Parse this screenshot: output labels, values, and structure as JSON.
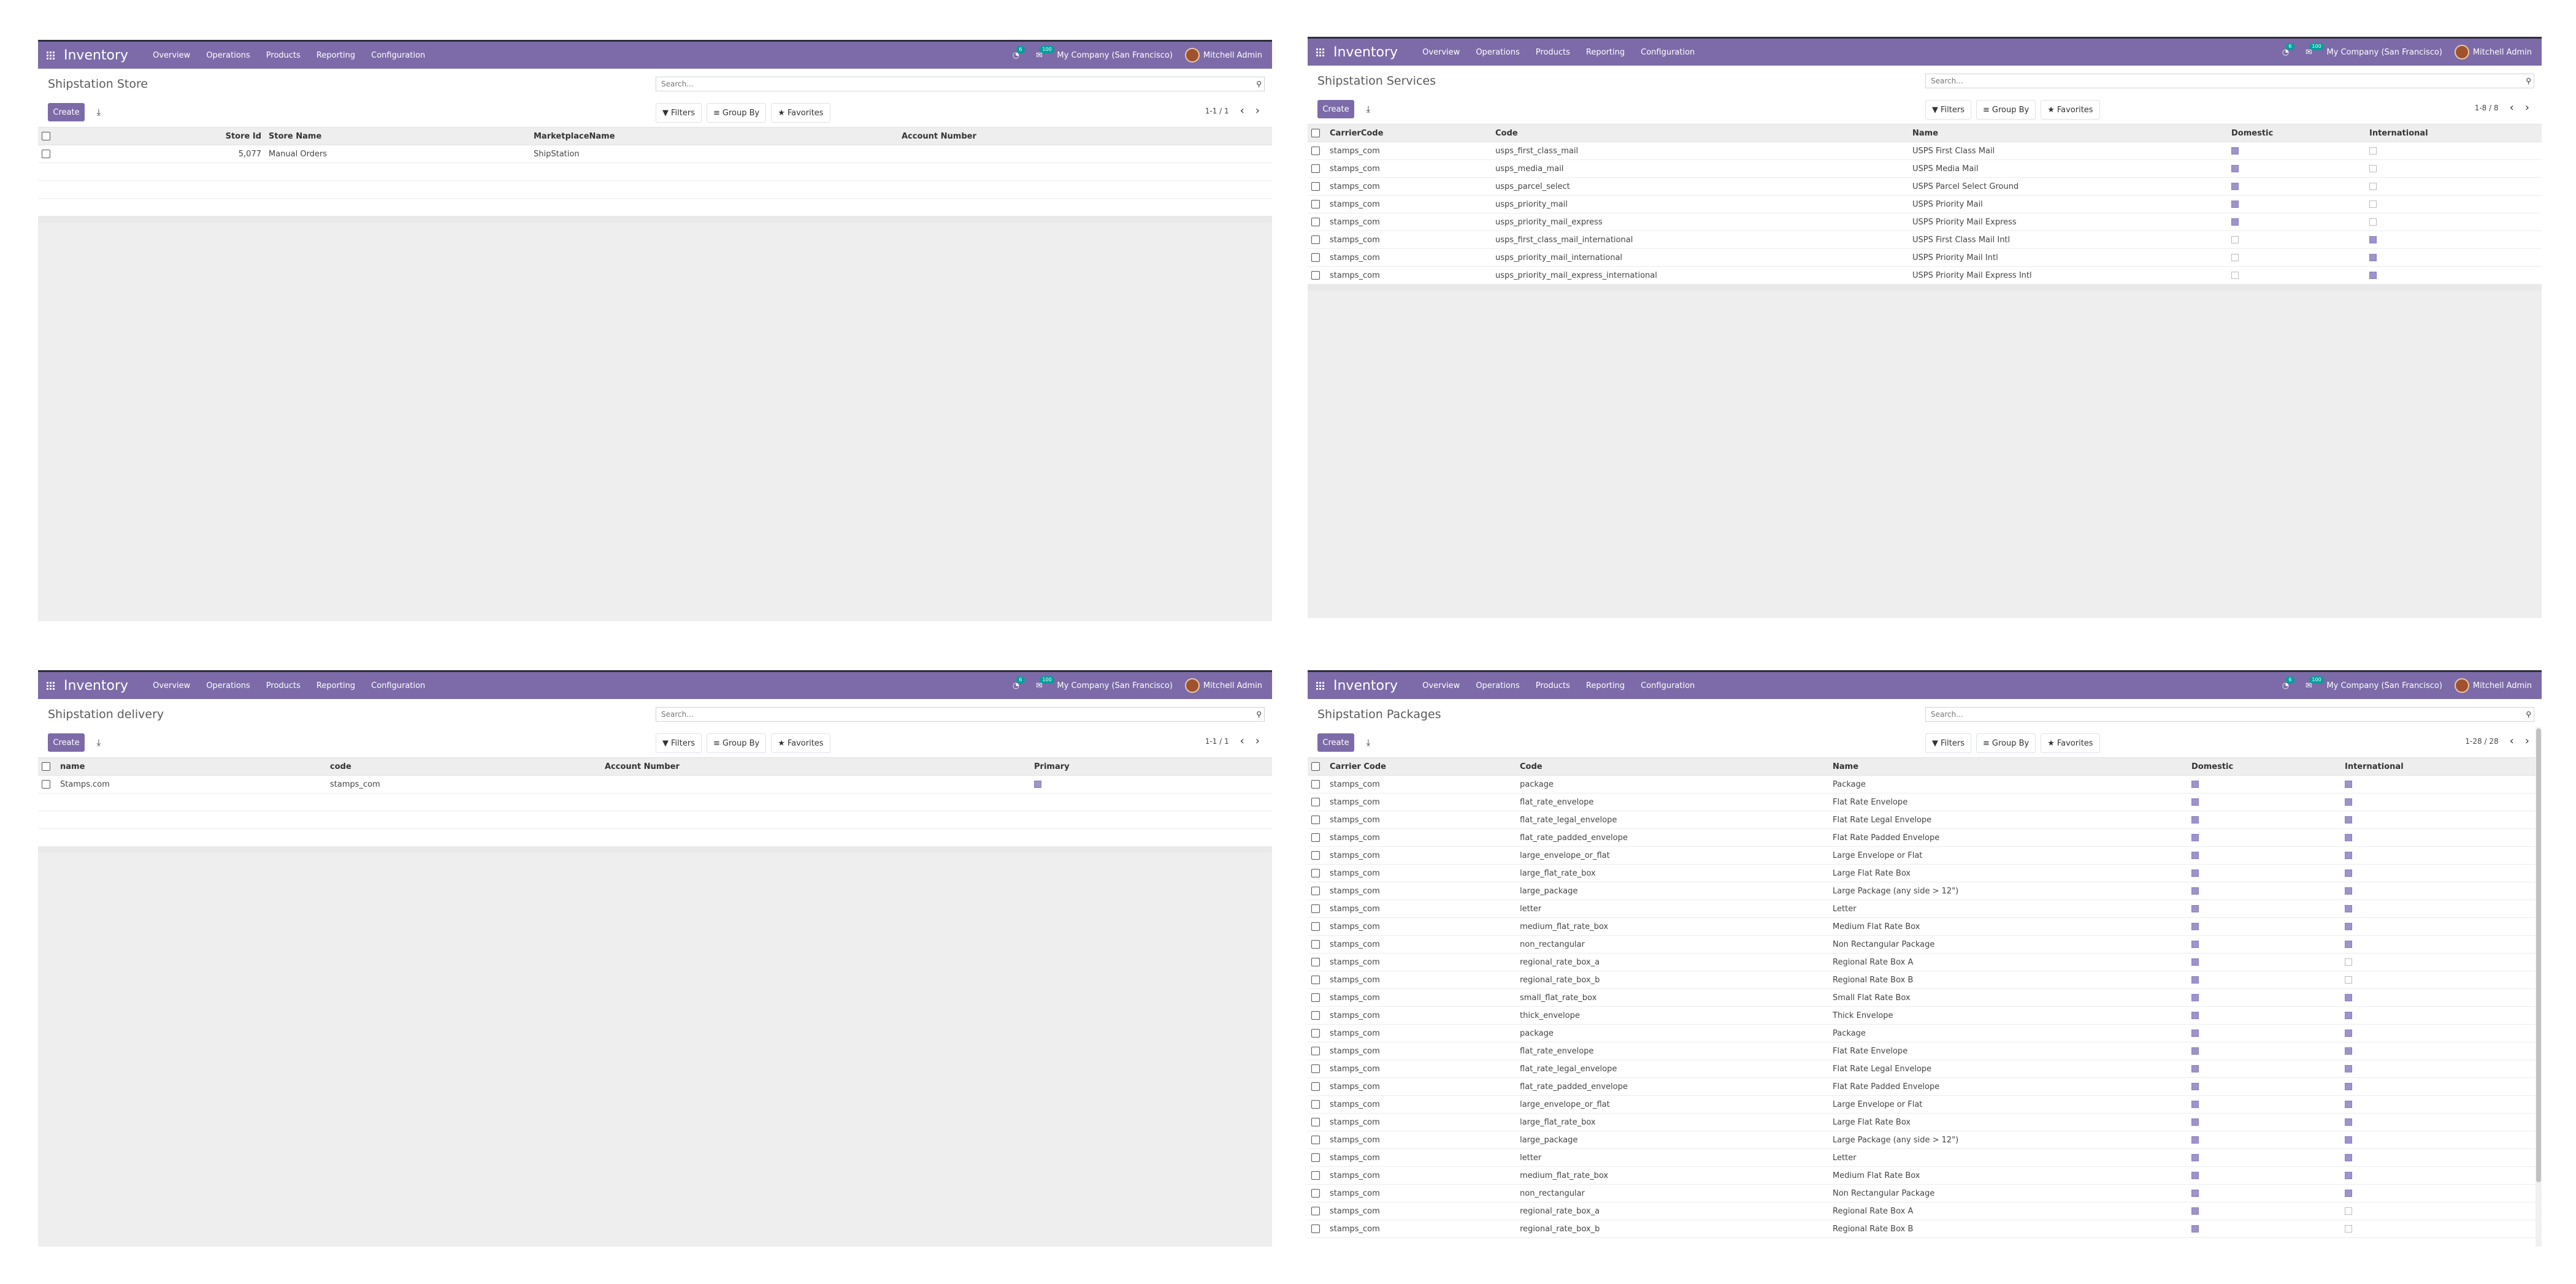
{
  "navbar": {
    "app_name": "Inventory",
    "menu": [
      "Overview",
      "Operations",
      "Products",
      "Reporting",
      "Configuration"
    ],
    "activity_badge": "6",
    "messages_badge": "100",
    "company": "My Company (San Francisco)",
    "user": "Mitchell Admin"
  },
  "common": {
    "create_label": "Create",
    "filters_label": "Filters",
    "groupby_label": "Group By",
    "favorites_label": "Favorites",
    "search_placeholder": "Search..."
  },
  "store": {
    "title": "Shipstation Store",
    "pager": "1-1 / 1",
    "columns": [
      "Store Id",
      "Store Name",
      "MarketplaceName",
      "Account Number"
    ],
    "rows": [
      [
        "5,077",
        "Manual Orders",
        "ShipStation",
        ""
      ]
    ]
  },
  "services": {
    "title": "Shipstation Services",
    "pager": "1-8 / 8",
    "columns": [
      "CarrierCode",
      "Code",
      "Name",
      "Domestic",
      "International"
    ],
    "rows": [
      {
        "carrier": "stamps_com",
        "code": "usps_first_class_mail",
        "name": "USPS First Class Mail",
        "domestic": true,
        "international": false
      },
      {
        "carrier": "stamps_com",
        "code": "usps_media_mail",
        "name": "USPS Media Mail",
        "domestic": true,
        "international": false
      },
      {
        "carrier": "stamps_com",
        "code": "usps_parcel_select",
        "name": "USPS Parcel Select Ground",
        "domestic": true,
        "international": false
      },
      {
        "carrier": "stamps_com",
        "code": "usps_priority_mail",
        "name": "USPS Priority Mail",
        "domestic": true,
        "international": false
      },
      {
        "carrier": "stamps_com",
        "code": "usps_priority_mail_express",
        "name": "USPS Priority Mail Express",
        "domestic": true,
        "international": false
      },
      {
        "carrier": "stamps_com",
        "code": "usps_first_class_mail_international",
        "name": "USPS First Class Mail Intl",
        "domestic": false,
        "international": true
      },
      {
        "carrier": "stamps_com",
        "code": "usps_priority_mail_international",
        "name": "USPS Priority Mail Intl",
        "domestic": false,
        "international": true
      },
      {
        "carrier": "stamps_com",
        "code": "usps_priority_mail_express_international",
        "name": "USPS Priority Mail Express Intl",
        "domestic": false,
        "international": true
      }
    ]
  },
  "delivery": {
    "title": "Shipstation delivery",
    "pager": "1-1 / 1",
    "columns": [
      "name",
      "code",
      "Account Number",
      "Primary"
    ],
    "rows": [
      {
        "name": "Stamps.com",
        "code": "stamps_com",
        "account": "",
        "primary": true
      }
    ]
  },
  "packages": {
    "title": "Shipstation Packages",
    "pager": "1-28 / 28",
    "columns": [
      "Carrier Code",
      "Code",
      "Name",
      "Domestic",
      "International"
    ],
    "rows": [
      {
        "carrier": "stamps_com",
        "code": "package",
        "name": "Package",
        "domestic": true,
        "international": true
      },
      {
        "carrier": "stamps_com",
        "code": "flat_rate_envelope",
        "name": "Flat Rate Envelope",
        "domestic": true,
        "international": true
      },
      {
        "carrier": "stamps_com",
        "code": "flat_rate_legal_envelope",
        "name": "Flat Rate Legal Envelope",
        "domestic": true,
        "international": true
      },
      {
        "carrier": "stamps_com",
        "code": "flat_rate_padded_envelope",
        "name": "Flat Rate Padded Envelope",
        "domestic": true,
        "international": true
      },
      {
        "carrier": "stamps_com",
        "code": "large_envelope_or_flat",
        "name": "Large Envelope or Flat",
        "domestic": true,
        "international": true
      },
      {
        "carrier": "stamps_com",
        "code": "large_flat_rate_box",
        "name": "Large Flat Rate Box",
        "domestic": true,
        "international": true
      },
      {
        "carrier": "stamps_com",
        "code": "large_package",
        "name": "Large Package (any side > 12\")",
        "domestic": true,
        "international": true
      },
      {
        "carrier": "stamps_com",
        "code": "letter",
        "name": "Letter",
        "domestic": true,
        "international": true
      },
      {
        "carrier": "stamps_com",
        "code": "medium_flat_rate_box",
        "name": "Medium Flat Rate Box",
        "domestic": true,
        "international": true
      },
      {
        "carrier": "stamps_com",
        "code": "non_rectangular",
        "name": "Non Rectangular Package",
        "domestic": true,
        "international": true
      },
      {
        "carrier": "stamps_com",
        "code": "regional_rate_box_a",
        "name": "Regional Rate Box A",
        "domestic": true,
        "international": false
      },
      {
        "carrier": "stamps_com",
        "code": "regional_rate_box_b",
        "name": "Regional Rate Box B",
        "domestic": true,
        "international": false
      },
      {
        "carrier": "stamps_com",
        "code": "small_flat_rate_box",
        "name": "Small Flat Rate Box",
        "domestic": true,
        "international": true
      },
      {
        "carrier": "stamps_com",
        "code": "thick_envelope",
        "name": "Thick Envelope",
        "domestic": true,
        "international": true
      },
      {
        "carrier": "stamps_com",
        "code": "package",
        "name": "Package",
        "domestic": true,
        "international": true
      },
      {
        "carrier": "stamps_com",
        "code": "flat_rate_envelope",
        "name": "Flat Rate Envelope",
        "domestic": true,
        "international": true
      },
      {
        "carrier": "stamps_com",
        "code": "flat_rate_legal_envelope",
        "name": "Flat Rate Legal Envelope",
        "domestic": true,
        "international": true
      },
      {
        "carrier": "stamps_com",
        "code": "flat_rate_padded_envelope",
        "name": "Flat Rate Padded Envelope",
        "domestic": true,
        "international": true
      },
      {
        "carrier": "stamps_com",
        "code": "large_envelope_or_flat",
        "name": "Large Envelope or Flat",
        "domestic": true,
        "international": true
      },
      {
        "carrier": "stamps_com",
        "code": "large_flat_rate_box",
        "name": "Large Flat Rate Box",
        "domestic": true,
        "international": true
      },
      {
        "carrier": "stamps_com",
        "code": "large_package",
        "name": "Large Package (any side > 12\")",
        "domestic": true,
        "international": true
      },
      {
        "carrier": "stamps_com",
        "code": "letter",
        "name": "Letter",
        "domestic": true,
        "international": true
      },
      {
        "carrier": "stamps_com",
        "code": "medium_flat_rate_box",
        "name": "Medium Flat Rate Box",
        "domestic": true,
        "international": true
      },
      {
        "carrier": "stamps_com",
        "code": "non_rectangular",
        "name": "Non Rectangular Package",
        "domestic": true,
        "international": true
      },
      {
        "carrier": "stamps_com",
        "code": "regional_rate_box_a",
        "name": "Regional Rate Box A",
        "domestic": true,
        "international": false
      },
      {
        "carrier": "stamps_com",
        "code": "regional_rate_box_b",
        "name": "Regional Rate Box B",
        "domestic": true,
        "international": false
      }
    ]
  }
}
